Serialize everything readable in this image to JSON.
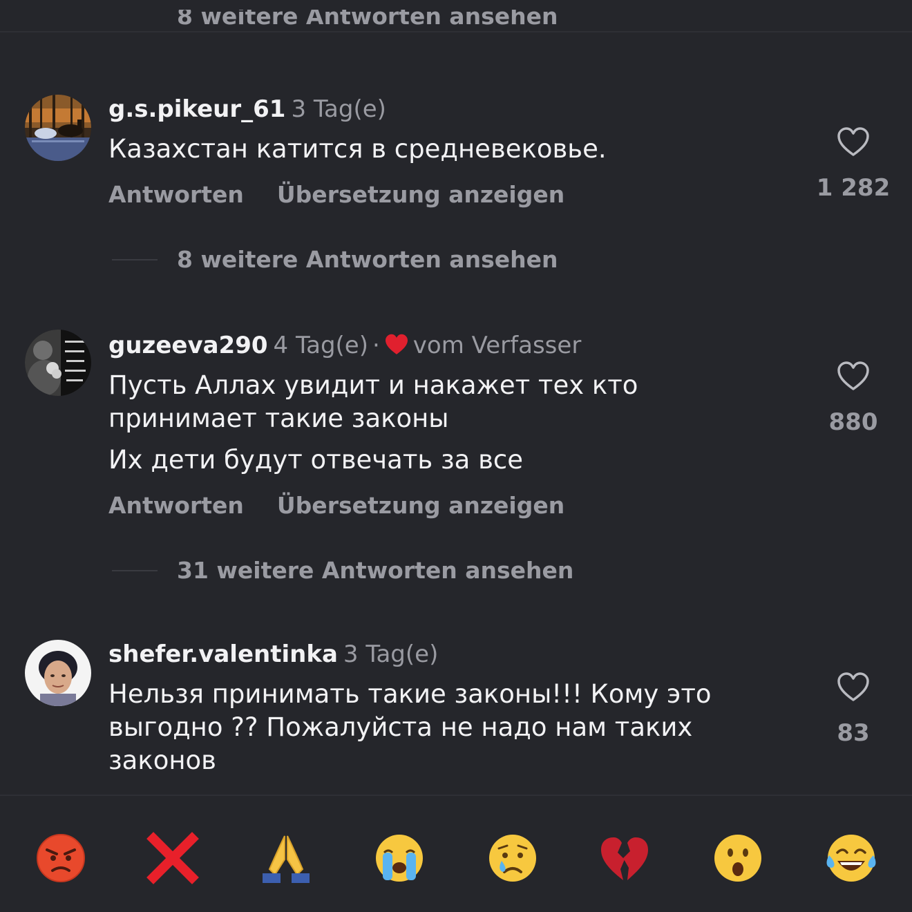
{
  "top_cut": {
    "text": "8 weitere Antworten ansehen"
  },
  "comments": [
    {
      "username": "g.s.pikeur_61",
      "time": "3 Tag(e)",
      "body": [
        "Казахстан катится в средневековье."
      ],
      "reply_label": "Antworten",
      "translate_label": "Übersetzung anzeigen",
      "likes": "1 282",
      "more_replies": "8 weitere Antworten ansehen"
    },
    {
      "username": "guzeeva290",
      "time": "4 Tag(e)",
      "separator": "·",
      "author_liked": "vom Verfasser",
      "body": [
        "Пусть Аллах увидит и накажет тех кто принимает  такие законы",
        "Их дети будут отвечать за все"
      ],
      "reply_label": "Antworten",
      "translate_label": "Übersetzung anzeigen",
      "likes": "880",
      "more_replies": "31 weitere Antworten ansehen"
    },
    {
      "username": "shefer.valentinka",
      "time": "3 Tag(e)",
      "body": [
        "Нельзя принимать такие законы!!! Кому это выгодно ?? Пожалуйста не надо нам таких законов"
      ],
      "likes": "83"
    }
  ],
  "emoji_bar": [
    "angry-face",
    "cross-mark",
    "folded-hands",
    "loudly-crying-face",
    "crying-face",
    "broken-heart",
    "astonished-face",
    "tears-of-joy-face"
  ],
  "colors": {
    "background": "#25262b",
    "text": "#f2f2f4",
    "muted": "#9a9ba2",
    "heart_red": "#e0202e"
  }
}
